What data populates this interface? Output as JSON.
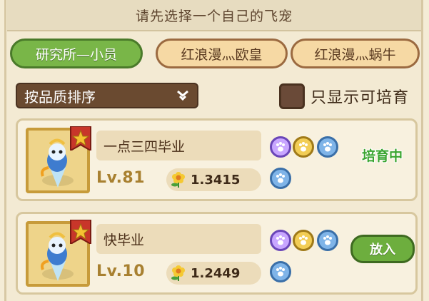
{
  "header": {
    "title": "请先选择一个自己的飞宠"
  },
  "tabs": [
    {
      "label": "研究所—小员",
      "active": true
    },
    {
      "label": "红浪漫灬欧皇",
      "active": false
    },
    {
      "label": "红浪漫灬蜗牛",
      "active": false
    }
  ],
  "sort": {
    "label": "按品质排序",
    "icon": "chevron-down-icon"
  },
  "filter": {
    "label": "只显示可培育",
    "checked": false
  },
  "pets": [
    {
      "name": "一点三四毕业",
      "level": "Lv.81",
      "power": "1.3415",
      "status": "培育中",
      "skills": [
        "purple-paw",
        "gold-paw",
        "blue-paw",
        "blue-paw"
      ]
    },
    {
      "name": "快毕业",
      "level": "Lv.10",
      "power": "1.2449",
      "action": "放入",
      "skills": [
        "purple-paw",
        "gold-paw",
        "blue-paw",
        "blue-paw"
      ]
    }
  ],
  "colors": {
    "active_tab": "#79b648",
    "status_green": "#3aa530",
    "brown": "#6a4a30"
  }
}
